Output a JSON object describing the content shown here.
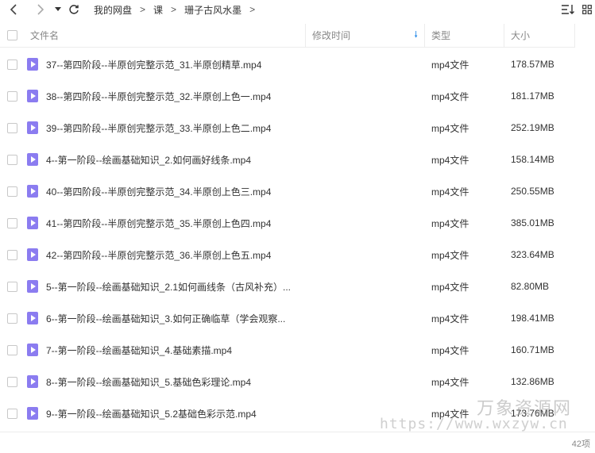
{
  "breadcrumb": [
    "我的网盘",
    "课",
    "珊子古风水墨"
  ],
  "columns": {
    "name": "文件名",
    "time": "修改时间",
    "type": "类型",
    "size": "大小"
  },
  "icons": {
    "back": "chevron-left-icon",
    "forward": "chevron-right-icon",
    "history": "caret-down-icon",
    "refresh": "refresh-icon",
    "sort": "sort-icon",
    "grid": "grid-icon",
    "sort_arrow": "arrow-down-icon",
    "file": "video-file-icon"
  },
  "accent_color": "#2e8ee8",
  "file_icon_color": "#8b7cf0",
  "files": [
    {
      "name": "37--第四阶段--半原创完整示范_31.半原创精草.mp4",
      "type": "mp4文件",
      "size": "178.57MB"
    },
    {
      "name": "38--第四阶段--半原创完整示范_32.半原创上色一.mp4",
      "type": "mp4文件",
      "size": "181.17MB"
    },
    {
      "name": "39--第四阶段--半原创完整示范_33.半原创上色二.mp4",
      "type": "mp4文件",
      "size": "252.19MB"
    },
    {
      "name": "4--第一阶段--绘画基础知识_2.如何画好线条.mp4",
      "type": "mp4文件",
      "size": "158.14MB"
    },
    {
      "name": "40--第四阶段--半原创完整示范_34.半原创上色三.mp4",
      "type": "mp4文件",
      "size": "250.55MB"
    },
    {
      "name": "41--第四阶段--半原创完整示范_35.半原创上色四.mp4",
      "type": "mp4文件",
      "size": "385.01MB"
    },
    {
      "name": "42--第四阶段--半原创完整示范_36.半原创上色五.mp4",
      "type": "mp4文件",
      "size": "323.64MB"
    },
    {
      "name": "5--第一阶段--绘画基础知识_2.1如何画线条（古风补充）...",
      "type": "mp4文件",
      "size": "82.80MB"
    },
    {
      "name": "6--第一阶段--绘画基础知识_3.如何正确临草（学会观察...",
      "type": "mp4文件",
      "size": "198.41MB"
    },
    {
      "name": "7--第一阶段--绘画基础知识_4.基础素描.mp4",
      "type": "mp4文件",
      "size": "160.71MB"
    },
    {
      "name": "8--第一阶段--绘画基础知识_5.基础色彩理论.mp4",
      "type": "mp4文件",
      "size": "132.86MB"
    },
    {
      "name": "9--第一阶段--绘画基础知识_5.2基础色彩示范.mp4",
      "type": "mp4文件",
      "size": "173.76MB"
    }
  ],
  "status": {
    "count": "42项"
  },
  "watermark": {
    "text": "万象资源网",
    "url": "https://www.wxzyw.cn"
  }
}
